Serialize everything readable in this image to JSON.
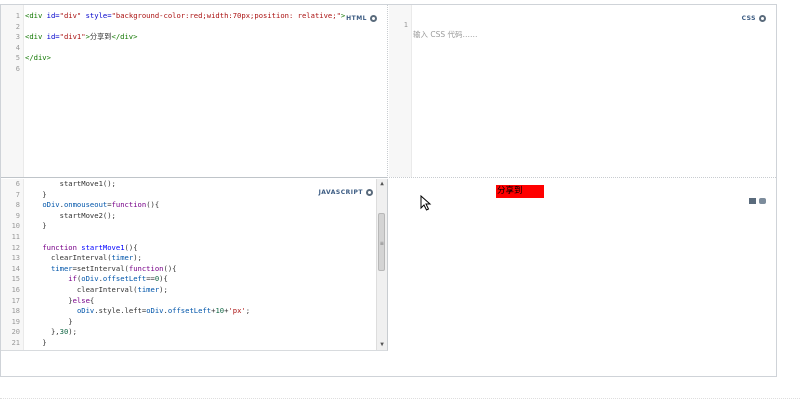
{
  "html_pane": {
    "label": "HTML",
    "lines": [
      {
        "n": "1",
        "parts": [
          [
            "tag",
            "&lt;div"
          ],
          [
            "plain",
            " "
          ],
          [
            "attr",
            "id="
          ],
          [
            "str",
            "\"div\""
          ],
          [
            "plain",
            " "
          ],
          [
            "attr",
            "style="
          ],
          [
            "str",
            "\"background-color:red;width:70px;position: relative;\""
          ],
          [
            "tag",
            "&gt;"
          ]
        ]
      },
      {
        "n": "2",
        "parts": []
      },
      {
        "n": "3",
        "parts": [
          [
            "tag",
            "&lt;div"
          ],
          [
            "plain",
            " "
          ],
          [
            "attr",
            "id="
          ],
          [
            "str",
            "\"div1\""
          ],
          [
            "tag",
            "&gt;"
          ],
          [
            "plain",
            "分享到"
          ],
          [
            "tag",
            "&lt;/div&gt;"
          ]
        ]
      },
      {
        "n": "4",
        "parts": []
      },
      {
        "n": "5",
        "parts": [
          [
            "tag",
            "&lt;/div&gt;"
          ]
        ]
      },
      {
        "n": "6",
        "parts": []
      }
    ]
  },
  "css_pane": {
    "label": "CSS",
    "line_number": "1",
    "placeholder": "输入 CSS 代码……"
  },
  "js_pane": {
    "label": "JAVASCRIPT",
    "lines": [
      {
        "n": "6",
        "parts": [
          [
            "plain",
            "        startMove1();"
          ]
        ]
      },
      {
        "n": "7",
        "parts": [
          [
            "plain",
            "    }"
          ]
        ]
      },
      {
        "n": "8",
        "parts": [
          [
            "plain",
            "    "
          ],
          [
            "var",
            "oDiv"
          ],
          [
            "plain",
            "."
          ],
          [
            "var",
            "onmouseout"
          ],
          [
            "plain",
            "="
          ],
          [
            "kw",
            "function"
          ],
          [
            "plain",
            "(){"
          ]
        ]
      },
      {
        "n": "9",
        "parts": [
          [
            "plain",
            "        startMove2();"
          ]
        ]
      },
      {
        "n": "10",
        "parts": [
          [
            "plain",
            "    }"
          ]
        ]
      },
      {
        "n": "11",
        "parts": []
      },
      {
        "n": "12",
        "parts": [
          [
            "plain",
            "    "
          ],
          [
            "kw",
            "function"
          ],
          [
            "plain",
            " "
          ],
          [
            "fn",
            "startMove1"
          ],
          [
            "plain",
            "(){"
          ]
        ]
      },
      {
        "n": "13",
        "parts": [
          [
            "plain",
            "      clearInterval("
          ],
          [
            "var",
            "timer"
          ],
          [
            "plain",
            ");"
          ]
        ]
      },
      {
        "n": "14",
        "parts": [
          [
            "plain",
            "      "
          ],
          [
            "var",
            "timer"
          ],
          [
            "plain",
            "=setInterval("
          ],
          [
            "kw",
            "function"
          ],
          [
            "plain",
            "(){"
          ]
        ]
      },
      {
        "n": "15",
        "parts": [
          [
            "plain",
            "          "
          ],
          [
            "kw",
            "if"
          ],
          [
            "plain",
            "("
          ],
          [
            "var",
            "oDiv"
          ],
          [
            "plain",
            "."
          ],
          [
            "var",
            "offsetLeft"
          ],
          [
            "plain",
            "=="
          ],
          [
            "num",
            "0"
          ],
          [
            "plain",
            "){"
          ]
        ]
      },
      {
        "n": "16",
        "parts": [
          [
            "plain",
            "            clearInterval("
          ],
          [
            "var",
            "timer"
          ],
          [
            "plain",
            ");"
          ]
        ]
      },
      {
        "n": "17",
        "parts": [
          [
            "plain",
            "          }"
          ],
          [
            "kw",
            "else"
          ],
          [
            "plain",
            "{"
          ]
        ]
      },
      {
        "n": "18",
        "parts": [
          [
            "plain",
            "            "
          ],
          [
            "var",
            "oDiv"
          ],
          [
            "plain",
            ".style.left="
          ],
          [
            "var",
            "oDiv"
          ],
          [
            "plain",
            "."
          ],
          [
            "var",
            "offsetLeft"
          ],
          [
            "plain",
            "+"
          ],
          [
            "num",
            "10"
          ],
          [
            "plain",
            "+"
          ],
          [
            "str",
            "'px'"
          ],
          [
            "plain",
            ";"
          ]
        ]
      },
      {
        "n": "19",
        "parts": [
          [
            "plain",
            "          }"
          ]
        ]
      },
      {
        "n": "20",
        "parts": [
          [
            "plain",
            "      },"
          ],
          [
            "num",
            "30"
          ],
          [
            "plain",
            ");"
          ]
        ]
      },
      {
        "n": "21",
        "parts": [
          [
            "plain",
            "    }"
          ]
        ]
      }
    ],
    "scroll_up": "▲",
    "scroll_down": "▼",
    "grip": "≡"
  },
  "result_pane": {
    "share_text": "分享到",
    "share_box_color": "#ff0000",
    "tools": [
      "grid-icon",
      "window-icon"
    ]
  }
}
